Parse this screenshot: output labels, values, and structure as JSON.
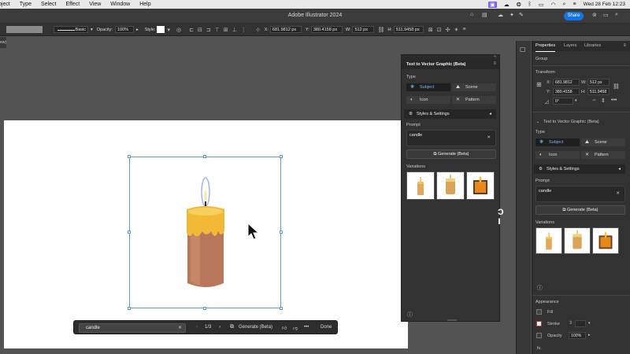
{
  "menubar": {
    "items": [
      "bject",
      "Type",
      "Select",
      "Effect",
      "View",
      "Window",
      "Help"
    ],
    "clock": "Wed 28 Feb 12:23"
  },
  "titlebar": {
    "title": "Adobe Illustrator 2024",
    "share_label": "Share"
  },
  "controlbar": {
    "stroke_label": "Basic",
    "opacity_label": "Opacity:",
    "opacity_value": "100%",
    "style_label": "Style:",
    "x_label": "X:",
    "x_value": "681.9812 px",
    "y_label": "Y:",
    "y_value": "380.4158 px",
    "w_label": "W:",
    "w_value": "512 px",
    "h_label": "H:",
    "h_value": "511.9458 px"
  },
  "left_tab": {
    "label": "ew)"
  },
  "context_bar": {
    "prompt_value": "candle",
    "pager": "1/3",
    "generate_label": "Generate (Beta)",
    "done_label": "Done"
  },
  "floating_panel": {
    "title": "Text to Vector Graphic (Beta)",
    "type_label": "Type",
    "types": [
      "Subject",
      "Scene",
      "Icon",
      "Pattern"
    ],
    "styles_label": "Styles & Settings",
    "prompt_label": "Prompt",
    "prompt_value": "candle",
    "generate_label": "Generate (Beta)",
    "variations_label": "Variations"
  },
  "properties_panel": {
    "tabs": [
      "Properties",
      "Layers",
      "Libraries"
    ],
    "group_label": "Group",
    "transform_label": "Transform",
    "x_label": "X:",
    "x_value": "681.9812",
    "w_label": "W:",
    "w_value": "512 px",
    "y_label": "Y:",
    "y_value": "380.4158",
    "h_label": "H:",
    "h_value": "511.9458",
    "rotate_label": "0°",
    "ttv_label": "Text to Vector Graphic (Beta)",
    "type_label": "Type",
    "types": [
      "Subject",
      "Scene",
      "Icon",
      "Pattern"
    ],
    "styles_label": "Styles & Settings",
    "prompt_label": "Prompt",
    "prompt_value": "candle",
    "generate_label": "Generate (Beta)",
    "variations_label": "Variations",
    "appearance_label": "Appearance",
    "fill_label": "Fill",
    "stroke_label": "Stroke",
    "opacity_label": "Opacity",
    "opacity_value": "100%",
    "fx_label": "fx."
  },
  "colors": {
    "accent": "#1473e6",
    "selection": "#5b9bd5",
    "flame": "#9fb6e0",
    "wax_top": "#f2b936",
    "wax_body": "#b8775a"
  }
}
